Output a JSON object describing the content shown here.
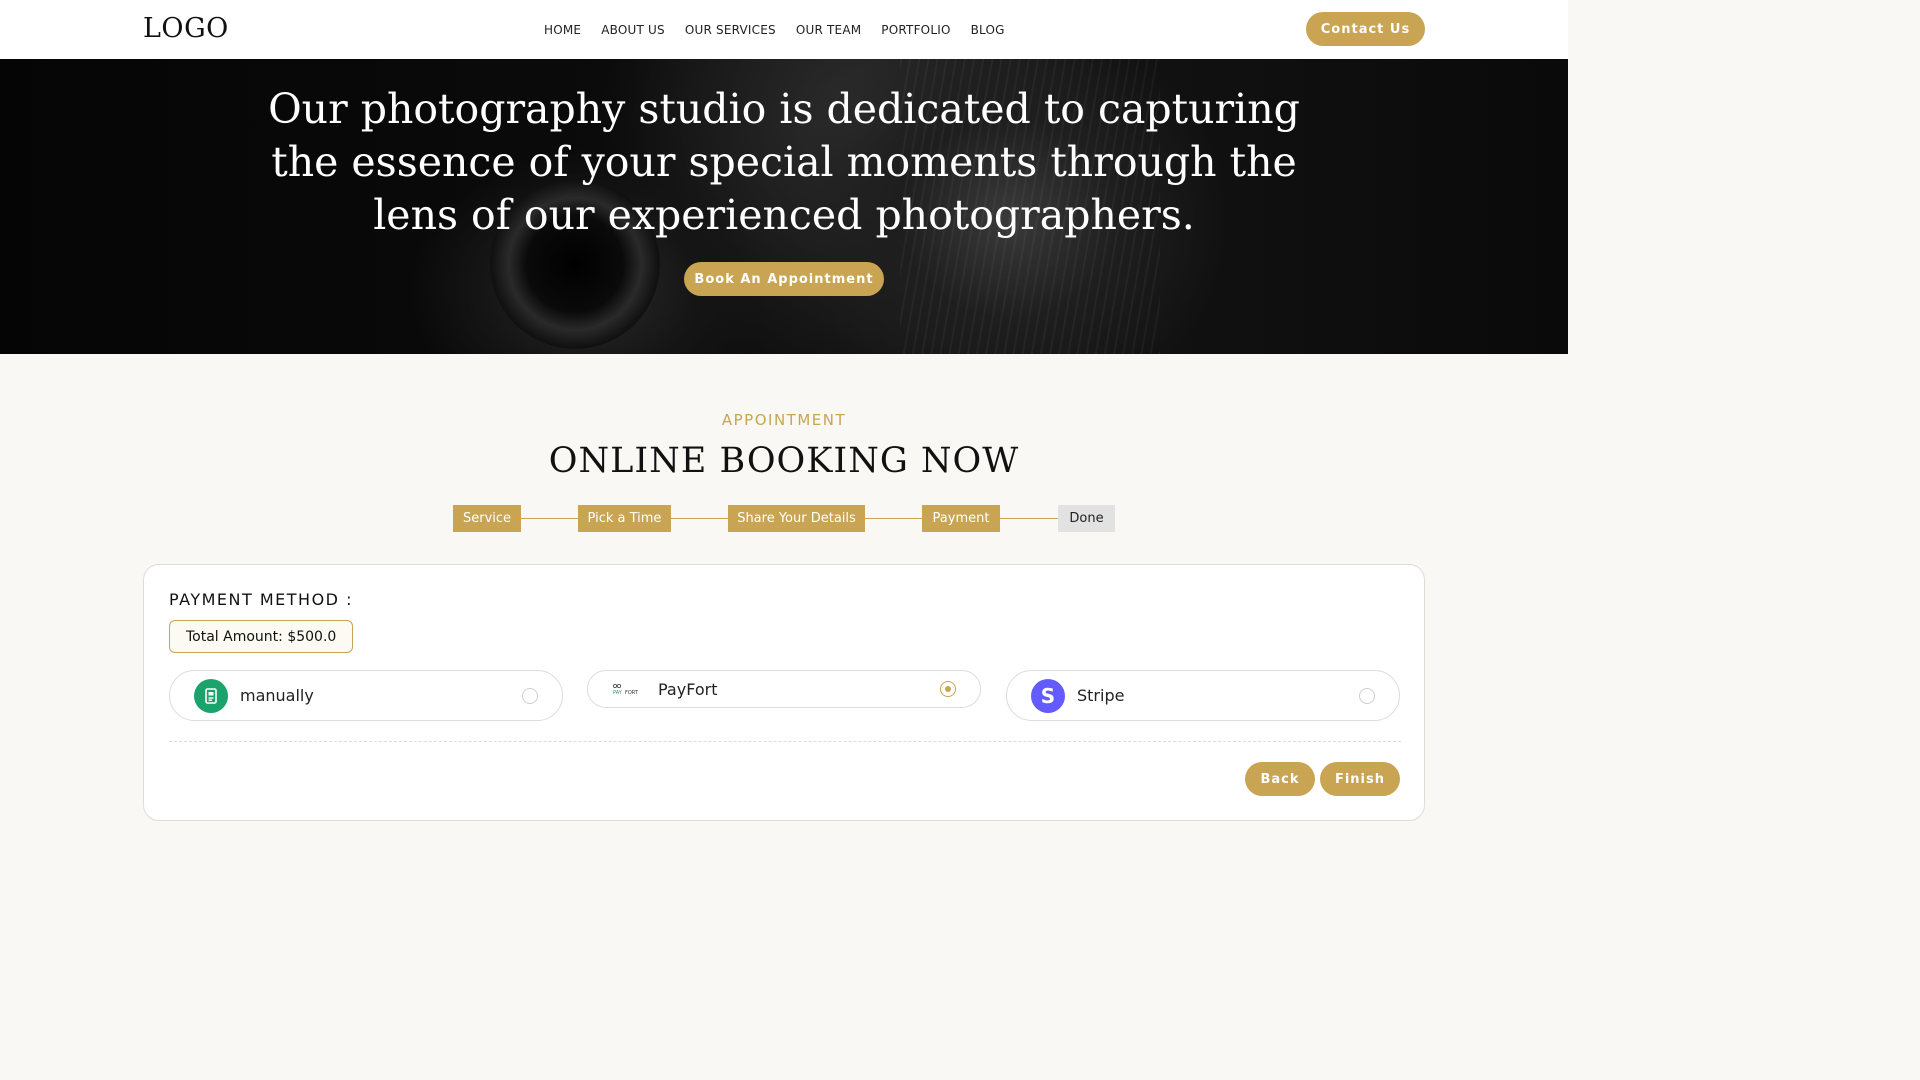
{
  "header": {
    "logo": "LOGO",
    "nav": [
      "HOME",
      "ABOUT US",
      "OUR SERVICES",
      "OUR TEAM",
      "PORTFOLIO",
      "BLOG"
    ],
    "contact_label": "Contact Us"
  },
  "hero": {
    "lines": [
      "Our photography studio is dedicated to capturing",
      "the essence of your special moments through the",
      "lens of our experienced photographers."
    ],
    "cta_label": "Book An Appointment"
  },
  "section": {
    "eyebrow": "APPOINTMENT",
    "title": "ONLINE BOOKING NOW"
  },
  "steps": [
    {
      "label": "Service",
      "state": "complete"
    },
    {
      "label": "Pick a Time",
      "state": "complete"
    },
    {
      "label": "Share Your Details",
      "state": "complete"
    },
    {
      "label": "Payment",
      "state": "active"
    },
    {
      "label": "Done",
      "state": "pending"
    }
  ],
  "payment": {
    "label": "PAYMENT METHOD :",
    "total": "Total Amount: $500.0",
    "methods": [
      {
        "label": "manually",
        "icon": "cash-icon",
        "selected": false
      },
      {
        "label": "PayFort",
        "icon": "payfort-logo",
        "selected": true
      },
      {
        "label": "Stripe",
        "icon": "stripe-icon",
        "selected": false
      }
    ],
    "back_label": "Back",
    "finish_label": "Finish"
  },
  "colors": {
    "accent": "#c9a453",
    "stripe": "#635bff",
    "manual": "#1aa36a"
  }
}
